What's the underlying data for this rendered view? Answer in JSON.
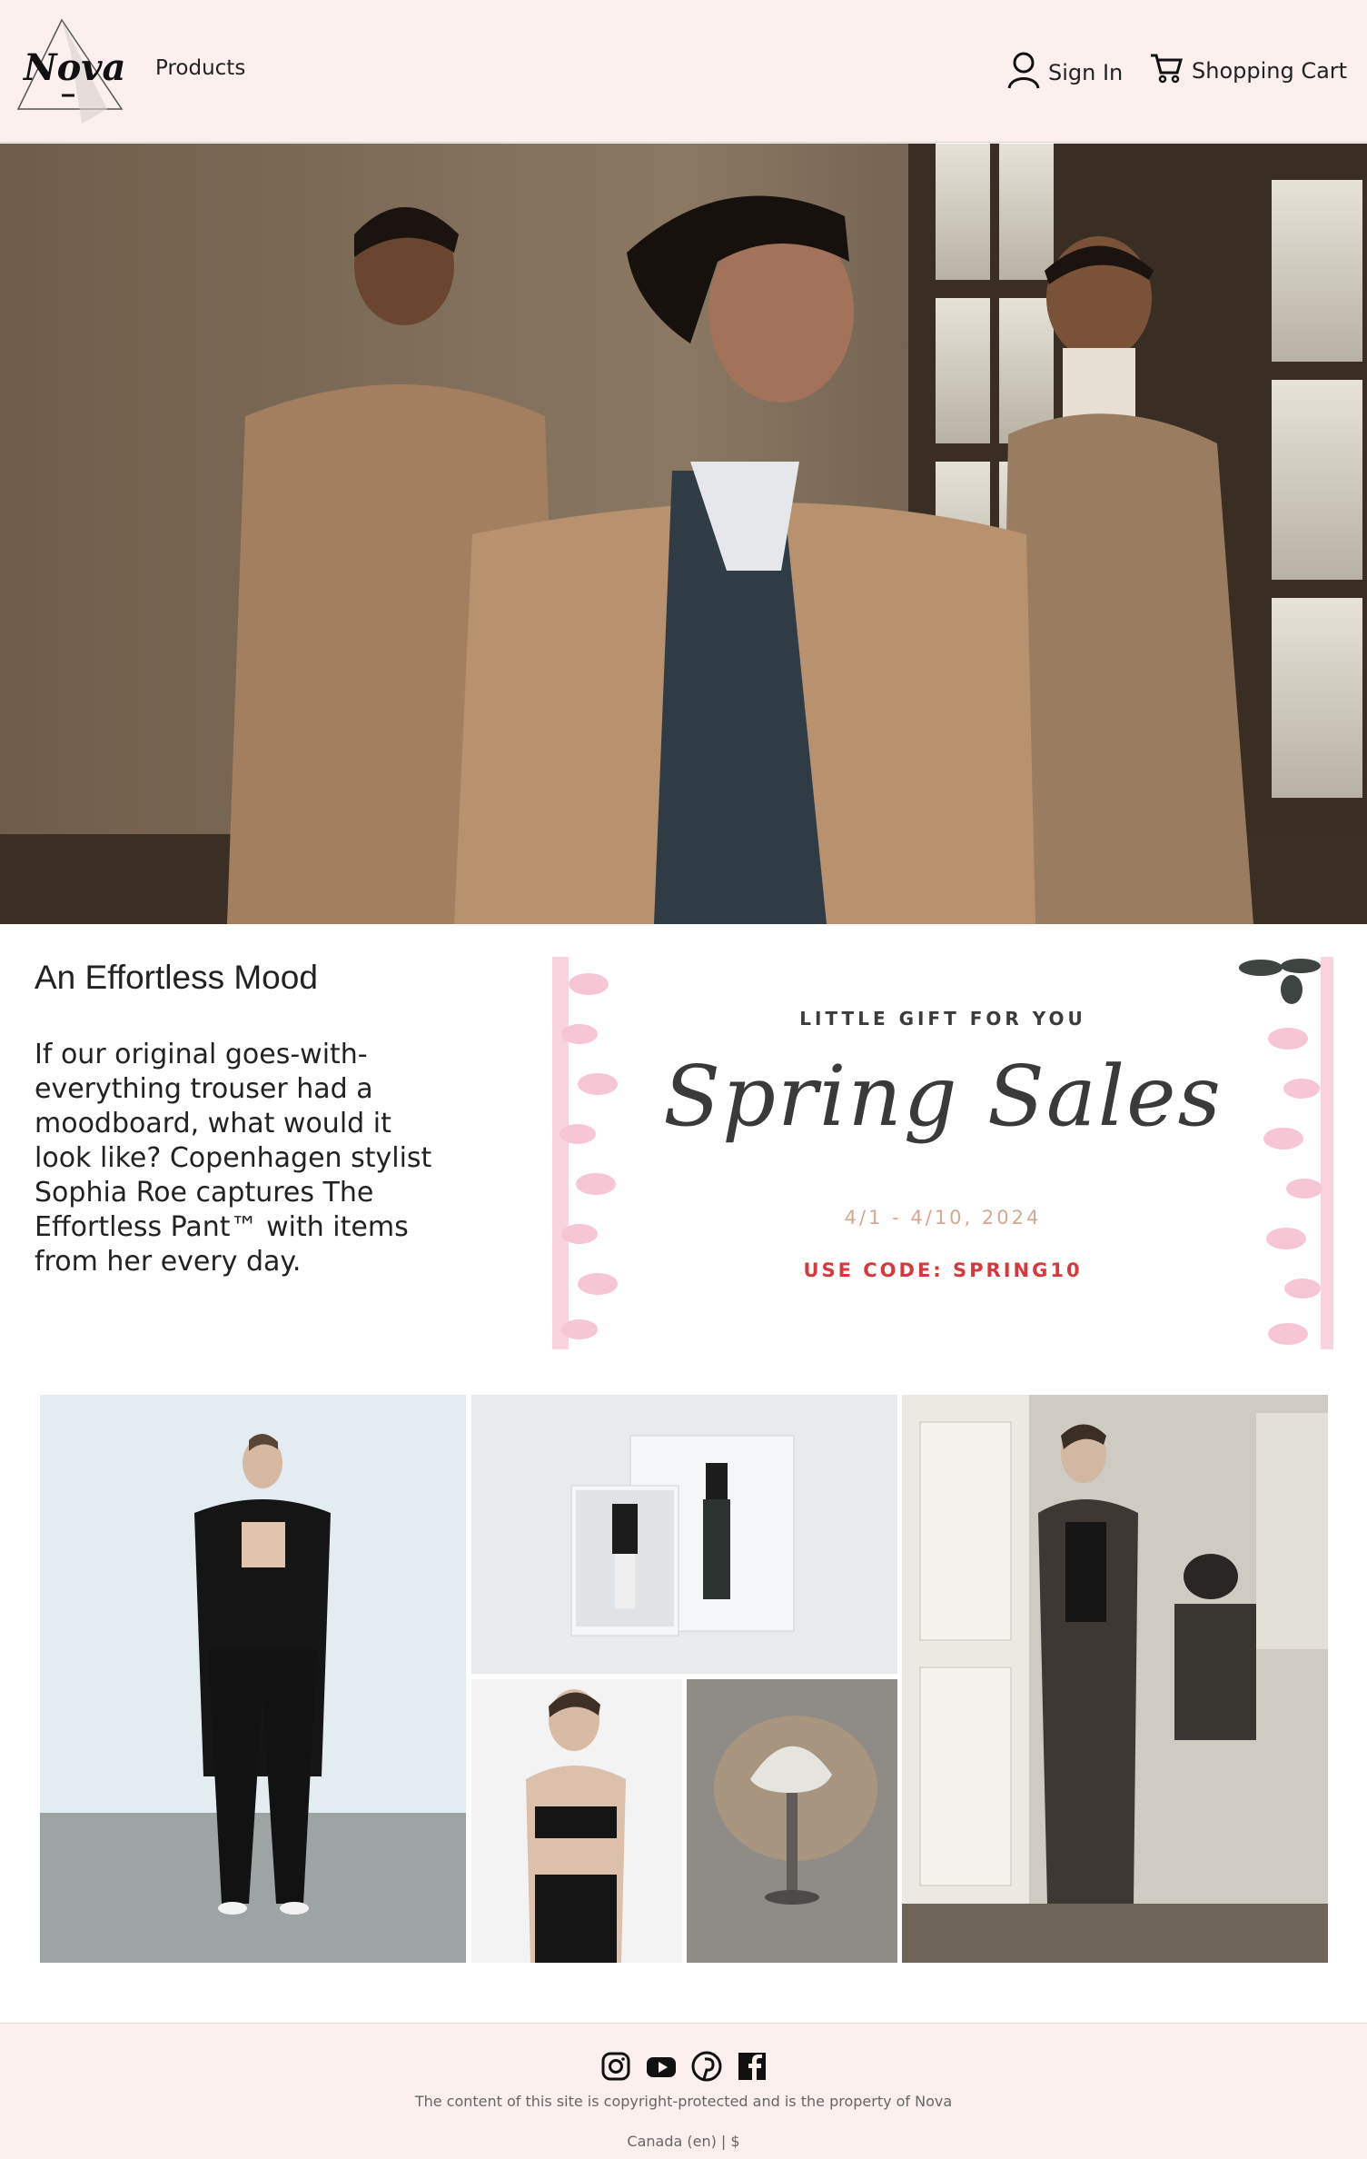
{
  "brand": {
    "logo_text": "Nova"
  },
  "nav": {
    "products": "Products",
    "sign_in": "Sign In",
    "cart": "Shopping Cart"
  },
  "intro": {
    "title": "An Effortless Mood",
    "body": "If our original goes-with-everything trouser had a moodboard, what would it look like? Copenhagen stylist Sophia Roe captures The Effortless Pant™ with items from her every day."
  },
  "promo": {
    "kicker": "LITTLE GIFT FOR YOU",
    "title": "Spring Sales",
    "dates": "4/1 - 4/10, 2024",
    "code": "USE CODE: SPRING10"
  },
  "footer": {
    "copyright": "The content of this site is copyright-protected and is the property of Nova",
    "locale": "Canada (en) | $"
  },
  "colors": {
    "header_bg": "#fbf0ee",
    "promo_code": "#d8383d",
    "promo_dates": "#d9a594"
  }
}
